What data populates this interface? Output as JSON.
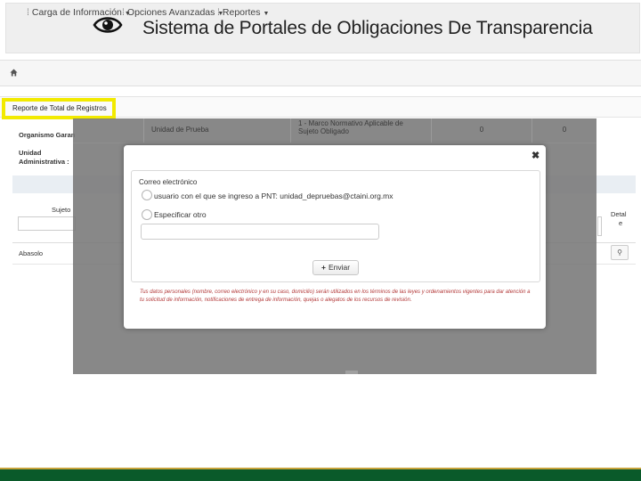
{
  "header": {
    "title": "Sistema de Portales de Obligaciones De Transparencia",
    "icon": "eye-icon"
  },
  "nav": {
    "home_icon": "home-icon",
    "items": [
      {
        "label": "Carga de Información"
      },
      {
        "label": "Opciones Avanzadas"
      },
      {
        "label": "Reportes"
      }
    ]
  },
  "breadcrumb": {
    "report_title": "Reporte de Total de Registros"
  },
  "background": {
    "organismo_label": "Organismo Garan",
    "unidad_label_1": "Unidad",
    "unidad_label_2": "Administrativa :",
    "sujeto_header": "Sujeto",
    "detalle_header_1": "Detal",
    "detalle_header_2": "e",
    "row_name": "Abasolo",
    "overlay_row": {
      "unit": "Unidad de Prueba",
      "framework": "1 - Marco Normativo Aplicable de Sujeto Obligado",
      "count1": "0",
      "count2": "0"
    }
  },
  "modal": {
    "legend": "Correo electrónico",
    "option1": "usuario con el que se ingreso a PNT: unidad_depruebas@ctaini.org.mx",
    "option2": "Especificar otro",
    "input_value": "",
    "send_label": "Enviar",
    "disclaimer": "Tus datos personales (nombre, correo electrónico y en su caso, domicilio) serán utilizados en los términos de las leyes y ordenamientos vigentes para dar atención a tu solicitud de información, notificaciones de entrega de información, quejas o alegatos de los recursos de revisión."
  },
  "colors": {
    "highlight": "#f2ea00",
    "footer": "#0a5a2a",
    "footer_stripe": "#c7a33a",
    "disclaimer": "#b33a3a"
  }
}
